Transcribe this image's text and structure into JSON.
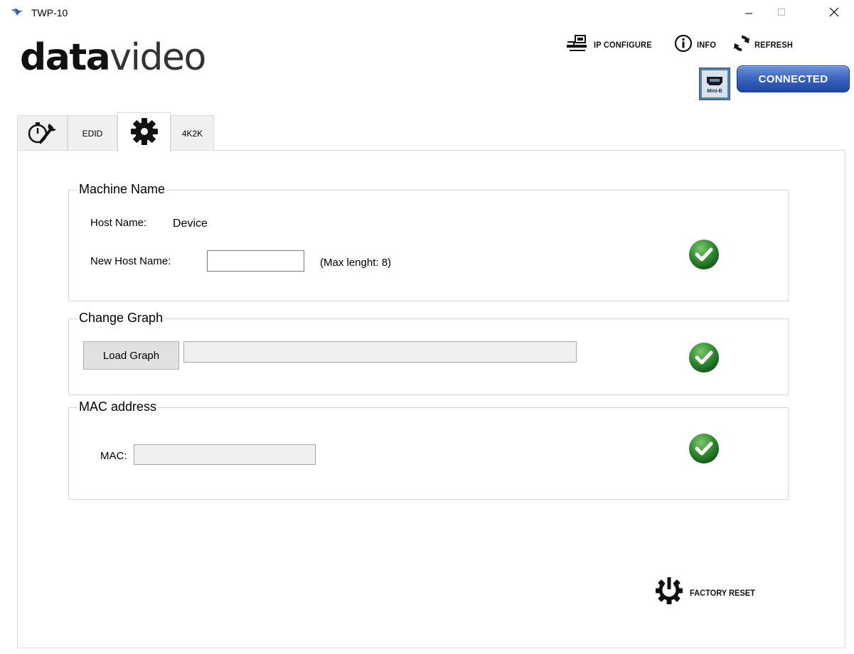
{
  "window": {
    "title": "TWP-10"
  },
  "logo": {
    "bold": "data",
    "light": "video"
  },
  "toolbar": {
    "ip_configure": "IP CONFIGURE",
    "info": "INFO",
    "refresh": "REFRESH"
  },
  "connection": {
    "port_label": "Mini-B",
    "status": "CONNECTED"
  },
  "tabs": [
    {
      "label": "",
      "icon": "stopwatch-wrench-icon"
    },
    {
      "label": "EDID"
    },
    {
      "label": "",
      "icon": "gear-icon",
      "active": true
    },
    {
      "label": "4K2K"
    }
  ],
  "machine_name": {
    "title": "Machine Name",
    "host_name_label": "Host Name:",
    "host_name_value": "Device",
    "new_host_name_label": "New Host Name:",
    "new_host_name_value": "",
    "hint": "(Max lenght: 8)"
  },
  "change_graph": {
    "title": "Change Graph",
    "load_button": "Load Graph",
    "path_value": ""
  },
  "mac": {
    "title": "MAC address",
    "label": "MAC:",
    "value": ""
  },
  "factory_reset": "FACTORY RESET",
  "colors": {
    "accent_blue": "#3d66c1",
    "ok_green": "#2f8a2f"
  }
}
